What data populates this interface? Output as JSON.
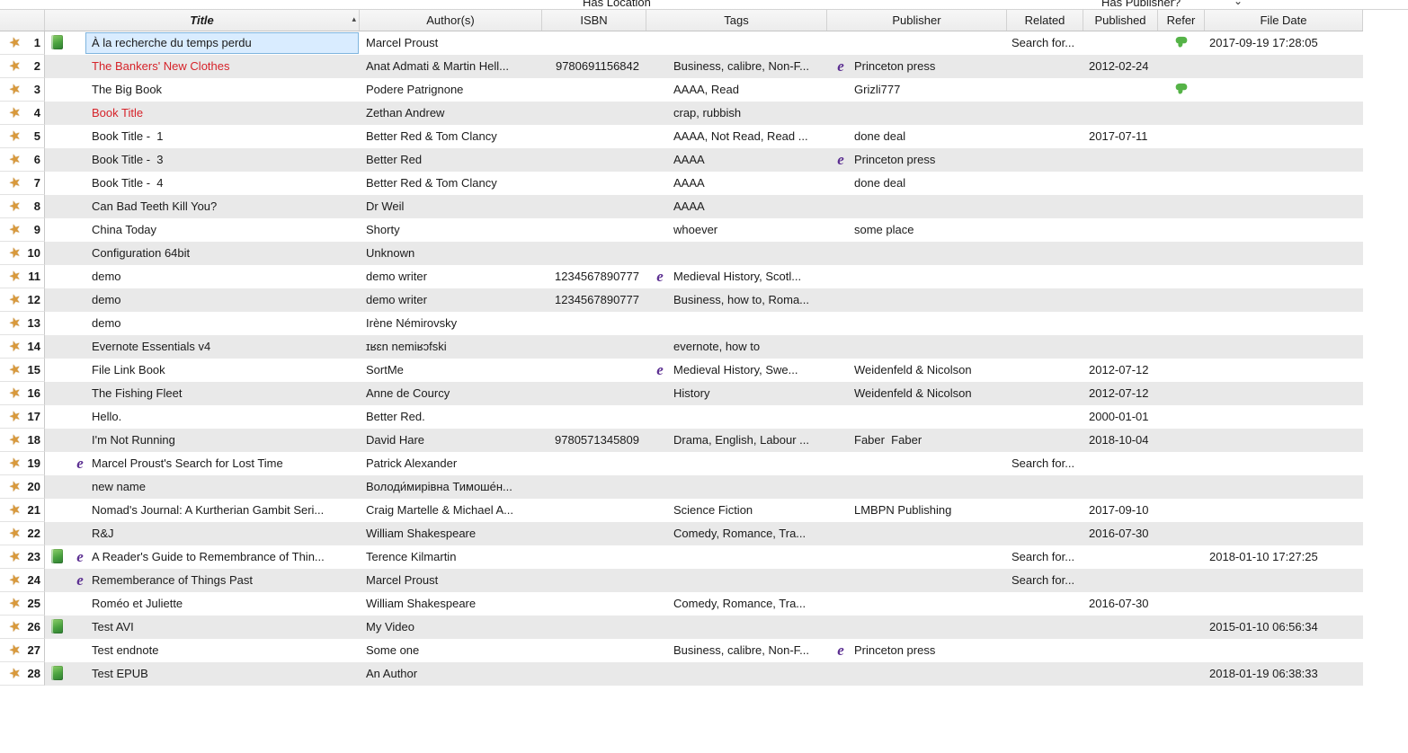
{
  "top_strip": {
    "has_location": "Has Location",
    "has_publisher": "Has Publisher?",
    "chevron": "⌄"
  },
  "header": {
    "columns": [
      "Title",
      "Author(s)",
      "ISBN",
      "Tags",
      "Publisher",
      "Related",
      "Published",
      "Refer",
      "File Date"
    ],
    "sort_indicator": "▴"
  },
  "icons": {
    "star": {
      "glyph": "★",
      "color": "#d9993b"
    },
    "book": {
      "color": "#43a047"
    },
    "ebook_e": {
      "glyph": "e",
      "color": "#5b2e91"
    },
    "evernote": {
      "color": "#55b347"
    }
  },
  "colors": {
    "red_title": "#d6232a",
    "selected_cell_bg": "#d9ecff",
    "selected_cell_border": "#7fb5de",
    "alt_row": "#e9e9e9"
  },
  "rows": [
    {
      "n": "1",
      "book": true,
      "sel": true,
      "title": "À la recherche du temps perdu",
      "author": "Marcel Proust",
      "related": "Search for...",
      "refer": true,
      "file": "2017-09-19 17:28:05"
    },
    {
      "n": "2",
      "red": true,
      "title": "The Bankers' New Clothes",
      "author": "Anat Admati & Martin Hell...",
      "isbn": "9780691156842",
      "tags": "Business, calibre, Non-F...",
      "pub_e": true,
      "publisher": "Princeton press",
      "published": "2012-02-24"
    },
    {
      "n": "3",
      "title": "The Big Book",
      "author": "Podere Patrignone",
      "tags": "AAAA, Read",
      "publisher": "Grizli777",
      "refer": true
    },
    {
      "n": "4",
      "red": true,
      "title": "Book Title",
      "author": "Zethan Andrew",
      "tags": "crap, rubbish"
    },
    {
      "n": "5",
      "title": "Book Title -  1",
      "author": "Better Red & Tom Clancy",
      "tags": "AAAA, Not Read, Read ...",
      "publisher": "done deal",
      "published": "2017-07-11"
    },
    {
      "n": "6",
      "title": "Book Title -  3",
      "author": "Better Red",
      "tags": "AAAA",
      "pub_e": true,
      "publisher": "Princeton press"
    },
    {
      "n": "7",
      "title": "Book Title -  4",
      "author": "Better Red & Tom Clancy",
      "tags": "AAAA",
      "publisher": "done deal"
    },
    {
      "n": "8",
      "title": "Can Bad Teeth Kill You?",
      "author": "Dr Weil",
      "tags": "AAAA"
    },
    {
      "n": "9",
      "title": "China Today",
      "author": "Shorty",
      "tags": "whoever",
      "publisher": "some place"
    },
    {
      "n": "10",
      "title": "Configuration 64bit",
      "author": "Unknown"
    },
    {
      "n": "11",
      "title": "demo",
      "author": "demo writer",
      "isbn": "1234567890777",
      "tags_e": true,
      "tags": "Medieval History, Scotl..."
    },
    {
      "n": "12",
      "title": "demo",
      "author": "demo writer",
      "isbn": "1234567890777",
      "tags": "Business, how to, Roma..."
    },
    {
      "n": "13",
      "title": "demo",
      "author": "Irène Némirovsky"
    },
    {
      "n": "14",
      "title": "Evernote Essentials v4",
      "author": "ɪʁɛn nemiʁɔfski",
      "tags": "evernote, how to"
    },
    {
      "n": "15",
      "title": "File Link Book",
      "author": "SortMe",
      "tags_e": true,
      "tags": "Medieval History, Swe...",
      "publisher": "Weidenfeld & Nicolson",
      "published": "2012-07-12"
    },
    {
      "n": "16",
      "title": "The Fishing Fleet",
      "author": "Anne de Courcy",
      "tags": "History",
      "publisher": "Weidenfeld & Nicolson",
      "published": "2012-07-12"
    },
    {
      "n": "17",
      "title": "Hello.",
      "author": "Better Red.",
      "published": "2000-01-01"
    },
    {
      "n": "18",
      "title": "I'm Not Running",
      "author": "David Hare",
      "isbn": "9780571345809",
      "tags": "Drama, English, Labour ...",
      "publisher": "Faber  Faber",
      "published": "2018-10-04"
    },
    {
      "n": "19",
      "e": true,
      "title": "Marcel Proust's Search for Lost Time",
      "author": "Patrick Alexander",
      "related": "Search for..."
    },
    {
      "n": "20",
      "title": "new name",
      "author": "Володи́мирівна Тимоше́н..."
    },
    {
      "n": "21",
      "title": "Nomad's Journal: A Kurtherian Gambit Seri...",
      "author": "Craig Martelle & Michael A...",
      "tags": "Science Fiction",
      "publisher": "LMBPN Publishing",
      "published": "2017-09-10"
    },
    {
      "n": "22",
      "title": "R&J",
      "author": "William Shakespeare",
      "tags": "Comedy, Romance, Tra...",
      "published": "2016-07-30"
    },
    {
      "n": "23",
      "book": true,
      "e": true,
      "title": "A Reader's Guide to Remembrance of Thin...",
      "author": "Terence Kilmartin",
      "related": "Search for...",
      "file": "2018-01-10 17:27:25"
    },
    {
      "n": "24",
      "e": true,
      "title": "Rememberance of Things Past",
      "author": "Marcel Proust",
      "related": "Search for..."
    },
    {
      "n": "25",
      "title": "Roméo et Juliette",
      "author": "William Shakespeare",
      "tags": "Comedy, Romance, Tra...",
      "published": "2016-07-30"
    },
    {
      "n": "26",
      "book": true,
      "title": "Test AVI",
      "author": "My Video",
      "file": "2015-01-10 06:56:34"
    },
    {
      "n": "27",
      "title": "Test endnote",
      "author": "Some one",
      "tags": "Business, calibre, Non-F...",
      "pub_e": true,
      "publisher": "Princeton press"
    },
    {
      "n": "28",
      "book": true,
      "title": "Test EPUB",
      "author": "An Author",
      "file": "2018-01-19 06:38:33"
    }
  ]
}
